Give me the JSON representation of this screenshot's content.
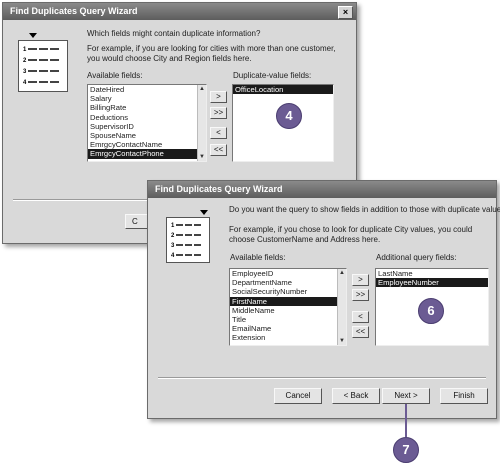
{
  "dialog1": {
    "title": "Find Duplicates Query Wizard",
    "close": "×",
    "question": "Which fields might contain duplicate information?",
    "example": "For example, if you are looking for cities with more than one customer, you would choose City and Region fields here.",
    "available_label": "Available fields:",
    "duplicate_label": "Duplicate-value fields:",
    "available_fields": [
      "DateHired",
      "Salary",
      "BillingRate",
      "Deductions",
      "SupervisorID",
      "SpouseName",
      "EmrgcyContactName",
      "EmrgcyContactPhone"
    ],
    "selected_available": "EmrgcyContactPhone",
    "duplicate_fields": [
      "OfficeLocation"
    ],
    "move_one": ">",
    "move_all": ">>",
    "remove_one": "<",
    "remove_all": "<<",
    "partial_button": "C",
    "graphic_rows": [
      "1",
      "2",
      "3",
      "4"
    ]
  },
  "dialog2": {
    "title": "Find Duplicates Query Wizard",
    "question": "Do you want the query to show fields in addition to those with duplicate values?",
    "example": "For example, if you chose to look for duplicate City values, you could choose CustomerName and Address here.",
    "available_label": "Available fields:",
    "additional_label": "Additional query fields:",
    "available_fields": [
      "EmployeeID",
      "DepartmentName",
      "SocialSecurityNumber",
      "FirstName",
      "MiddleName",
      "Title",
      "EmailName",
      "Extension"
    ],
    "selected_available": "FirstName",
    "additional_fields": [
      "LastName",
      "EmployeeNumber"
    ],
    "selected_additional": "EmployeeNumber",
    "move_one": ">",
    "move_all": ">>",
    "remove_one": "<",
    "remove_all": "<<",
    "cancel": "Cancel",
    "back": "< Back",
    "next": "Next >",
    "finish": "Finish",
    "graphic_rows": [
      "1",
      "2",
      "3",
      "4"
    ]
  },
  "callouts": {
    "step4": "4",
    "step6": "6",
    "step7": "7",
    "color": "#6b5b93"
  }
}
